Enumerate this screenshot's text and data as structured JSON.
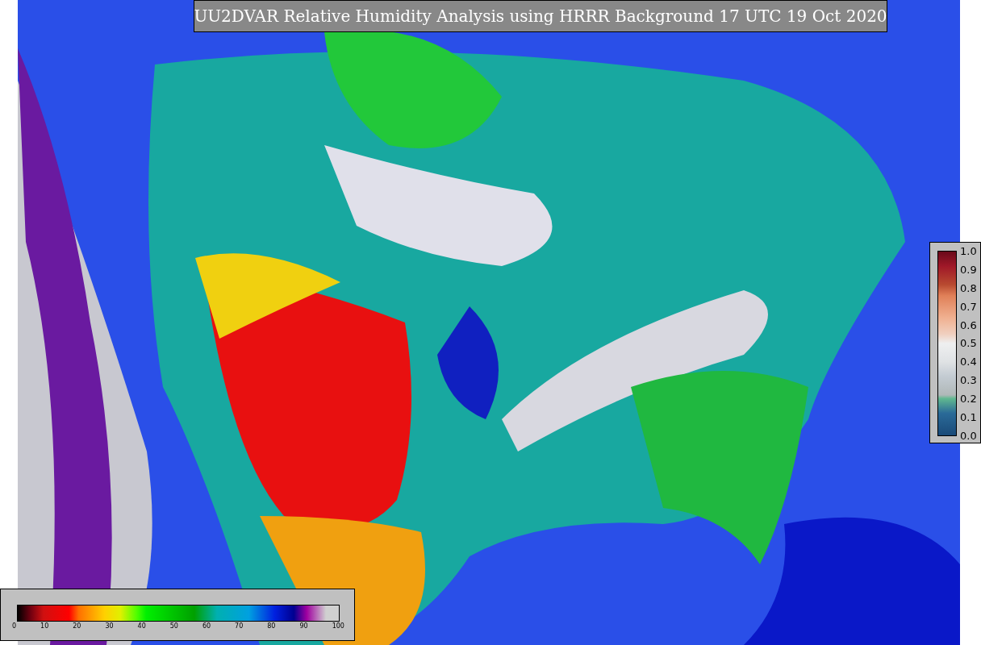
{
  "title": "UU2DVAR Relative Humidity Analysis using HRRR Background 17 UTC 19 Oct 2020",
  "humidity_colorbar": {
    "ticks": [
      "0",
      "10",
      "20",
      "30",
      "40",
      "50",
      "60",
      "70",
      "80",
      "90",
      "100"
    ]
  },
  "fraction_colorbar": {
    "ticks": [
      "1.0",
      "0.9",
      "0.8",
      "0.7",
      "0.6",
      "0.5",
      "0.4",
      "0.3",
      "0.2",
      "0.1",
      "0.0"
    ]
  }
}
